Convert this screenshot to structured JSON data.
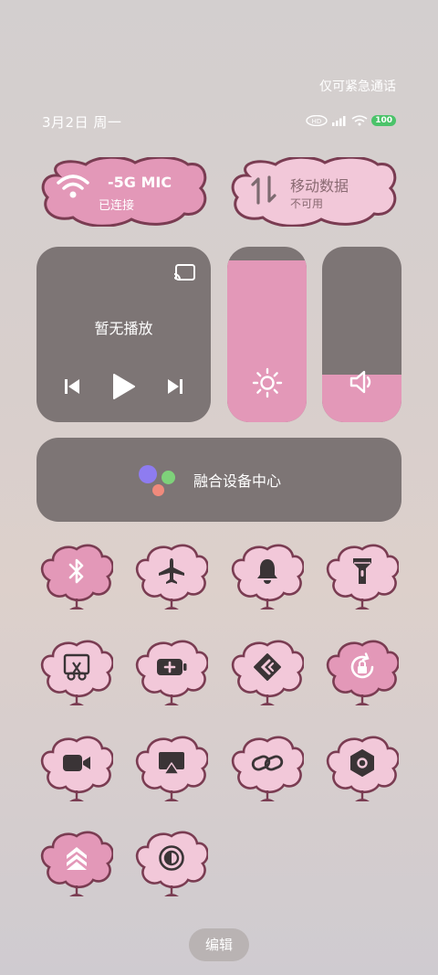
{
  "status_bar": {
    "emergency": "仅可紧急通话",
    "date": "3月2日 周一",
    "battery": "100"
  },
  "wifi_tile": {
    "name": "-5G     MIC",
    "status": "已连接",
    "active": true
  },
  "data_tile": {
    "name": "移动数据",
    "status": "不可用",
    "active": false
  },
  "media": {
    "title": "暂无播放"
  },
  "brightness": {
    "level": 0.92
  },
  "volume": {
    "level": 0.27
  },
  "device_center": {
    "label": "融合设备中心"
  },
  "toggles": [
    {
      "icon": "bluetooth-icon",
      "active": true
    },
    {
      "icon": "airplane-icon",
      "active": false
    },
    {
      "icon": "bell-icon",
      "active": false
    },
    {
      "icon": "flashlight-icon",
      "active": false
    },
    {
      "icon": "screenshot-icon",
      "active": false
    },
    {
      "icon": "battery-saver-icon",
      "active": false
    },
    {
      "icon": "share-icon",
      "active": false
    },
    {
      "icon": "rotation-lock-icon",
      "active": true
    },
    {
      "icon": "screen-record-icon",
      "active": false
    },
    {
      "icon": "screen-cast-icon",
      "active": false
    },
    {
      "icon": "link-icon",
      "active": false
    },
    {
      "icon": "nfc-icon",
      "active": false
    },
    {
      "icon": "performance-mode-icon",
      "active": true
    },
    {
      "icon": "dark-mode-icon",
      "active": false
    }
  ],
  "edit_label": "编辑",
  "colors": {
    "accent_pink": "#e398b8",
    "light_pink": "#f2c8d9",
    "outline": "#7a3c52",
    "card_gray": "#7d7575"
  }
}
